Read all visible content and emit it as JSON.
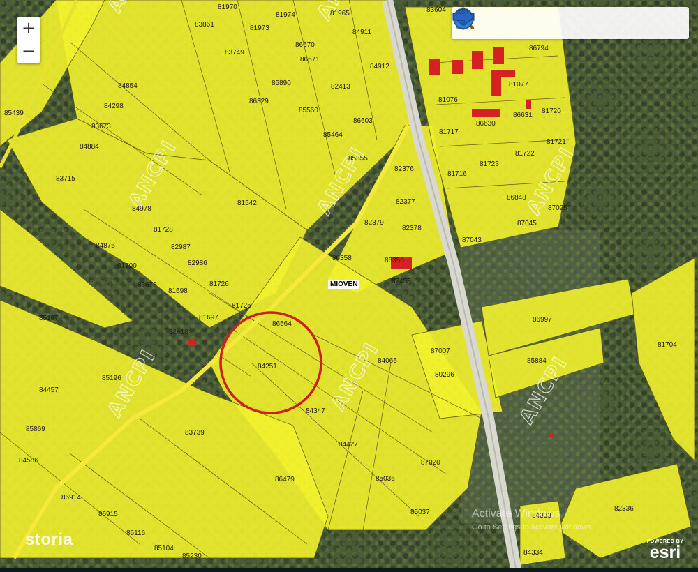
{
  "map": {
    "town_label": "MIOVEN",
    "watermark_text": "ANCPI",
    "parcel_color": "#f2f22e",
    "highlight_color": "#cc1f1f",
    "parcel_numbers": [
      "81970",
      "81974",
      "81965",
      "83604",
      "86794",
      "83861",
      "81973",
      "84911",
      "86670",
      "83749",
      "86671",
      "84912",
      "84854",
      "85890",
      "82413",
      "81077",
      "86329",
      "85560",
      "81076",
      "81720",
      "84298",
      "85439",
      "86603",
      "86630",
      "86631",
      "83673",
      "85464",
      "81717",
      "81721",
      "84884",
      "85355",
      "81722",
      "82376",
      "81723",
      "81716",
      "83715",
      "81542",
      "86848",
      "82377",
      "87025",
      "84978",
      "82379",
      "82378",
      "87045",
      "81728",
      "87043",
      "84876",
      "82987",
      "86358",
      "86356",
      "81700",
      "82986",
      "82453",
      "83678",
      "81698",
      "81726",
      "81725",
      "86997",
      "85197",
      "82418",
      "81697",
      "86564",
      "81704",
      "87007",
      "84251",
      "84066",
      "85884",
      "85196",
      "80296",
      "84457",
      "84347",
      "85869",
      "83739",
      "84427",
      "84586",
      "87020",
      "86479",
      "85036",
      "86914",
      "84333",
      "82336",
      "86915",
      "85037",
      "85116",
      "85104",
      "84334",
      "85230"
    ]
  },
  "controls": {
    "zoom_in": "+",
    "zoom_out": "−",
    "toolbar_icons": [
      "zoom-in-magnifier-icon",
      "zoom-out-magnifier-icon",
      "pan-hand-icon",
      "globe-icon",
      "back-arrow-icon",
      "forward-arrow-icon"
    ]
  },
  "branding": {
    "storia": "storia",
    "esri_powered_by": "POWERED BY",
    "esri": "esri"
  },
  "windows_notice": {
    "heading": "Activate Windows",
    "sub": "Go to Settings to activate Windows."
  }
}
